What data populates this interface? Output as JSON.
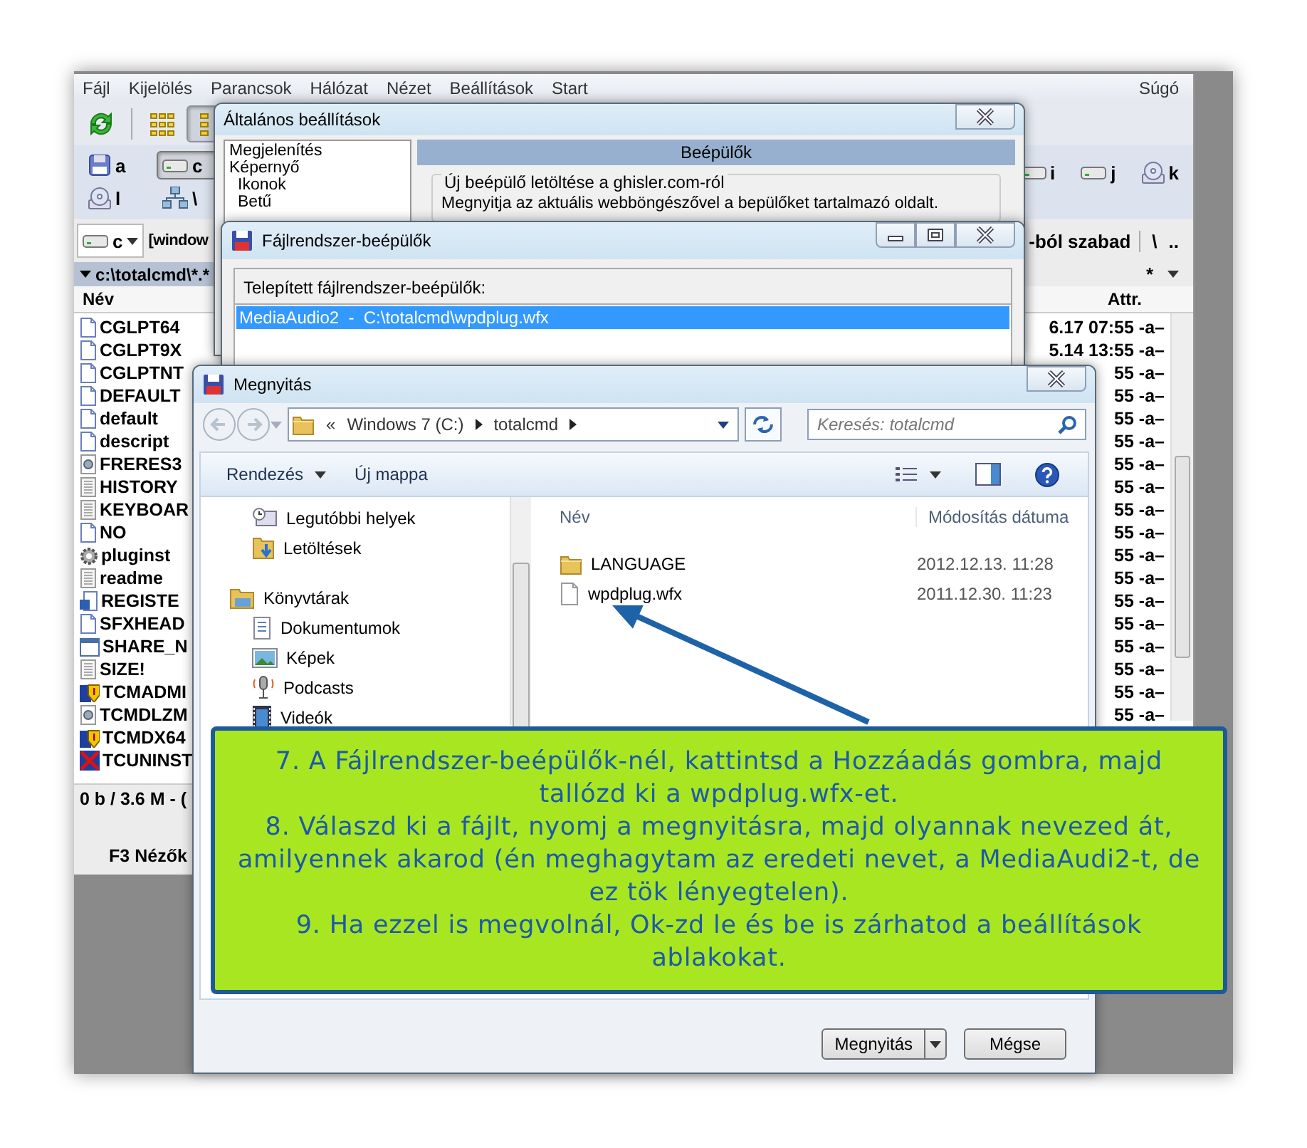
{
  "main_window": {
    "menu": [
      "Fájl",
      "Kijelölés",
      "Parancsok",
      "Hálózat",
      "Nézet",
      "Beállítások",
      "Start",
      "Súgó"
    ],
    "toolbar": [
      {
        "kind": "refresh",
        "pressed": false
      },
      {
        "kind": "brief",
        "pressed": false
      },
      {
        "kind": "full",
        "pressed": true
      }
    ],
    "drives_left": [
      {
        "label": "a",
        "kind": "floppy",
        "selected": false
      },
      {
        "label": "c",
        "kind": "hdd",
        "selected": true
      },
      {
        "label": "l",
        "kind": "cd",
        "selected": false
      },
      {
        "label": "\\",
        "kind": "net",
        "selected": false
      }
    ],
    "drives_right": [
      {
        "label": "i",
        "kind": "hdd",
        "selected": false
      },
      {
        "label": "j",
        "kind": "hdd",
        "selected": false
      },
      {
        "label": "k",
        "kind": "cd",
        "selected": false
      }
    ],
    "drive_combo": "c",
    "path_label": "[window",
    "free_space": "-ból szabad",
    "root_button": "\\",
    "up_button": "..",
    "path": "c:\\totalcmd\\*.*",
    "filter_button": "*",
    "columns": [
      "Név",
      "Attr."
    ],
    "files": [
      {
        "name": "CGLPT64",
        "kind": "page"
      },
      {
        "name": "CGLPT9X",
        "kind": "page"
      },
      {
        "name": "CGLPTNT",
        "kind": "page"
      },
      {
        "name": "DEFAULT",
        "kind": "page"
      },
      {
        "name": "default",
        "kind": "page"
      },
      {
        "name": "descript",
        "kind": "page"
      },
      {
        "name": "FRERES3",
        "kind": "app"
      },
      {
        "name": "HISTORY",
        "kind": "text"
      },
      {
        "name": "KEYBOAR",
        "kind": "text"
      },
      {
        "name": "NO",
        "kind": "page"
      },
      {
        "name": "pluginst",
        "kind": "gear"
      },
      {
        "name": "readme",
        "kind": "text"
      },
      {
        "name": "REGISTE",
        "kind": "word"
      },
      {
        "name": "SFXHEAD",
        "kind": "page"
      },
      {
        "name": "SHARE_N",
        "kind": "window"
      },
      {
        "name": "SIZE!",
        "kind": "text"
      },
      {
        "name": "TCMADMI",
        "kind": "shield"
      },
      {
        "name": "TCMDLZM",
        "kind": "app"
      },
      {
        "name": "TCMDX64",
        "kind": "shield"
      },
      {
        "name": "TCUNINST",
        "kind": "uninstall"
      }
    ],
    "right_rows": [
      "6.17 07:55 -a–",
      "5.14 13:55 -a–",
      "55 -a–",
      "55 -a–",
      "55 -a–",
      "55 -a–",
      "55 -a–",
      "55 -a–",
      "55 -a–",
      "55 -a–",
      "55 -a–",
      "55 -a–",
      "55 -a–",
      "55 -a–",
      "55 -a–",
      "55 -a–",
      "55 -a–",
      "55 -a–"
    ],
    "status": "0 b / 3.6 M - (",
    "function_key": "F3 Nézők"
  },
  "settings_dialog": {
    "title": "Általános beállítások",
    "tree": [
      {
        "label": "Megjelenítés"
      },
      {
        "label": "Képernyő",
        "children": [
          {
            "label": "Ikonok"
          },
          {
            "label": "Betű"
          }
        ]
      }
    ],
    "section_title": "Beépülők",
    "group_title": "Új beépülő letöltése a ghisler.com-ról",
    "group_text": "Megnyitja az aktuális webböngészővel a bepülőket tartalmazó oldalt."
  },
  "plugins_dialog": {
    "title": "Fájlrendszer-beépülők",
    "list_label": "Telepített fájlrendszer-beépülők:",
    "items": [
      {
        "text": "MediaAudio2  -  C:\\totalcmd\\wpdplug.wfx",
        "selected": true
      }
    ]
  },
  "open_dialog": {
    "title": "Megnyitás",
    "address": {
      "overflow": "«",
      "segments": [
        "Windows 7 (C:)",
        "totalcmd"
      ]
    },
    "search_placeholder": "Keresés: totalcmd",
    "toolbar": [
      "Rendezés",
      "Új mappa"
    ],
    "nav": [
      {
        "items": [
          {
            "label": "Legutóbbi helyek",
            "kind": "recent"
          },
          {
            "label": "Letöltések",
            "kind": "downloads"
          }
        ]
      },
      {
        "label": "Könyvtárak",
        "items": [
          {
            "label": "Dokumentumok",
            "kind": "documents"
          },
          {
            "label": "Képek",
            "kind": "pictures"
          },
          {
            "label": "Podcasts",
            "kind": "podcasts"
          },
          {
            "label": "Videók",
            "kind": "videos"
          }
        ]
      }
    ],
    "columns": [
      "Név",
      "Módosítás dátuma"
    ],
    "files": [
      {
        "name": "LANGUAGE",
        "kind": "folder",
        "date": "2012.12.13. 11:28"
      },
      {
        "name": "wpdplug.wfx",
        "kind": "file",
        "date": "2011.12.30. 11:23"
      }
    ],
    "buttons": [
      {
        "label": "Megnyitás",
        "split": true
      },
      {
        "label": "Mégse",
        "split": false
      }
    ]
  },
  "callout": {
    "paragraphs": [
      "7. A Fájlrendszer-beépülők-nél, kattintsd a Hozzáadás gombra, majd tallózd ki a wpdplug.wfx-et.",
      "8. Válaszd ki a fájlt, nyomj a megnyitásra, majd olyannak nevezed át, amilyennek akarod (én meghagytam az eredeti nevet, a MediaAudi2-t, de ez tök lényegtelen).",
      "9. Ha ezzel is megvolnál, Ok-zd le és be is zárhatod a beállítások ablakokat."
    ]
  }
}
